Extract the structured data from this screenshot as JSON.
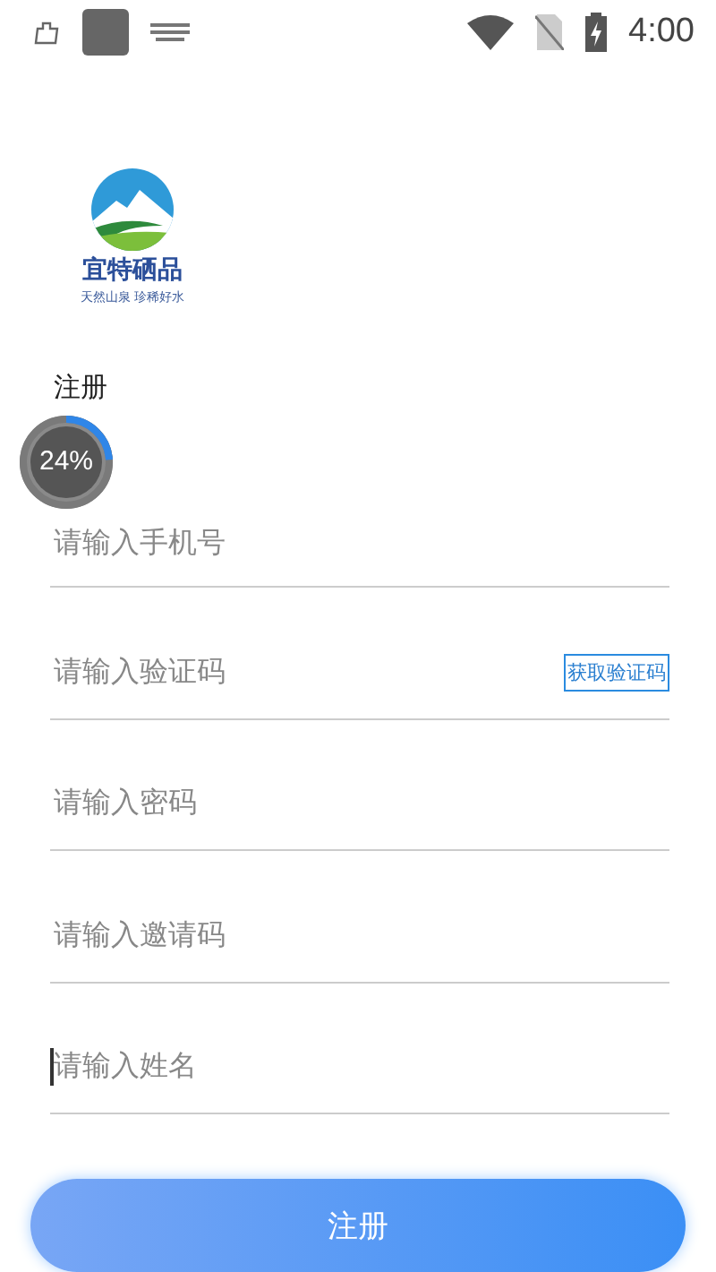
{
  "status_bar": {
    "time": "4:00"
  },
  "logo": {
    "name": "宜特硒品",
    "tagline": "天然山泉 珍稀好水"
  },
  "title": "注册",
  "progress": {
    "level": 0.24,
    "reading": "24%"
  },
  "fields": [
    {
      "kind": "text",
      "placeholder": "请输入手机号",
      "focused": false
    },
    {
      "kind": "code",
      "placeholder": "请输入验证码",
      "focused": false,
      "action": "获取验证码"
    },
    {
      "kind": "text",
      "placeholder": "请输入密码",
      "focused": false
    },
    {
      "kind": "text",
      "placeholder": "请输入邀请码",
      "focused": false
    },
    {
      "kind": "text",
      "placeholder": "请输入姓名",
      "focused": true
    }
  ],
  "submit": "注册"
}
